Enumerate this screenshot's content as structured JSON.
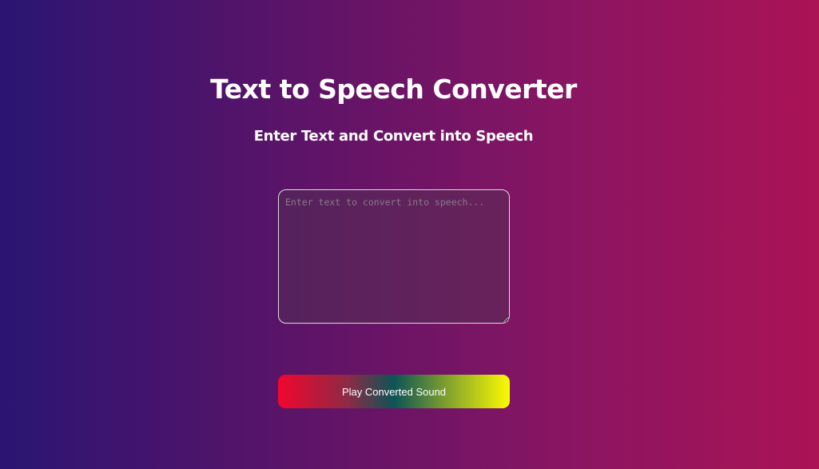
{
  "header": {
    "title": "Text to Speech Converter",
    "subtitle": "Enter Text and Convert into Speech"
  },
  "input": {
    "value": "",
    "placeholder": "Enter text to convert into speech..."
  },
  "play_button": {
    "label": "Play Converted Sound"
  }
}
